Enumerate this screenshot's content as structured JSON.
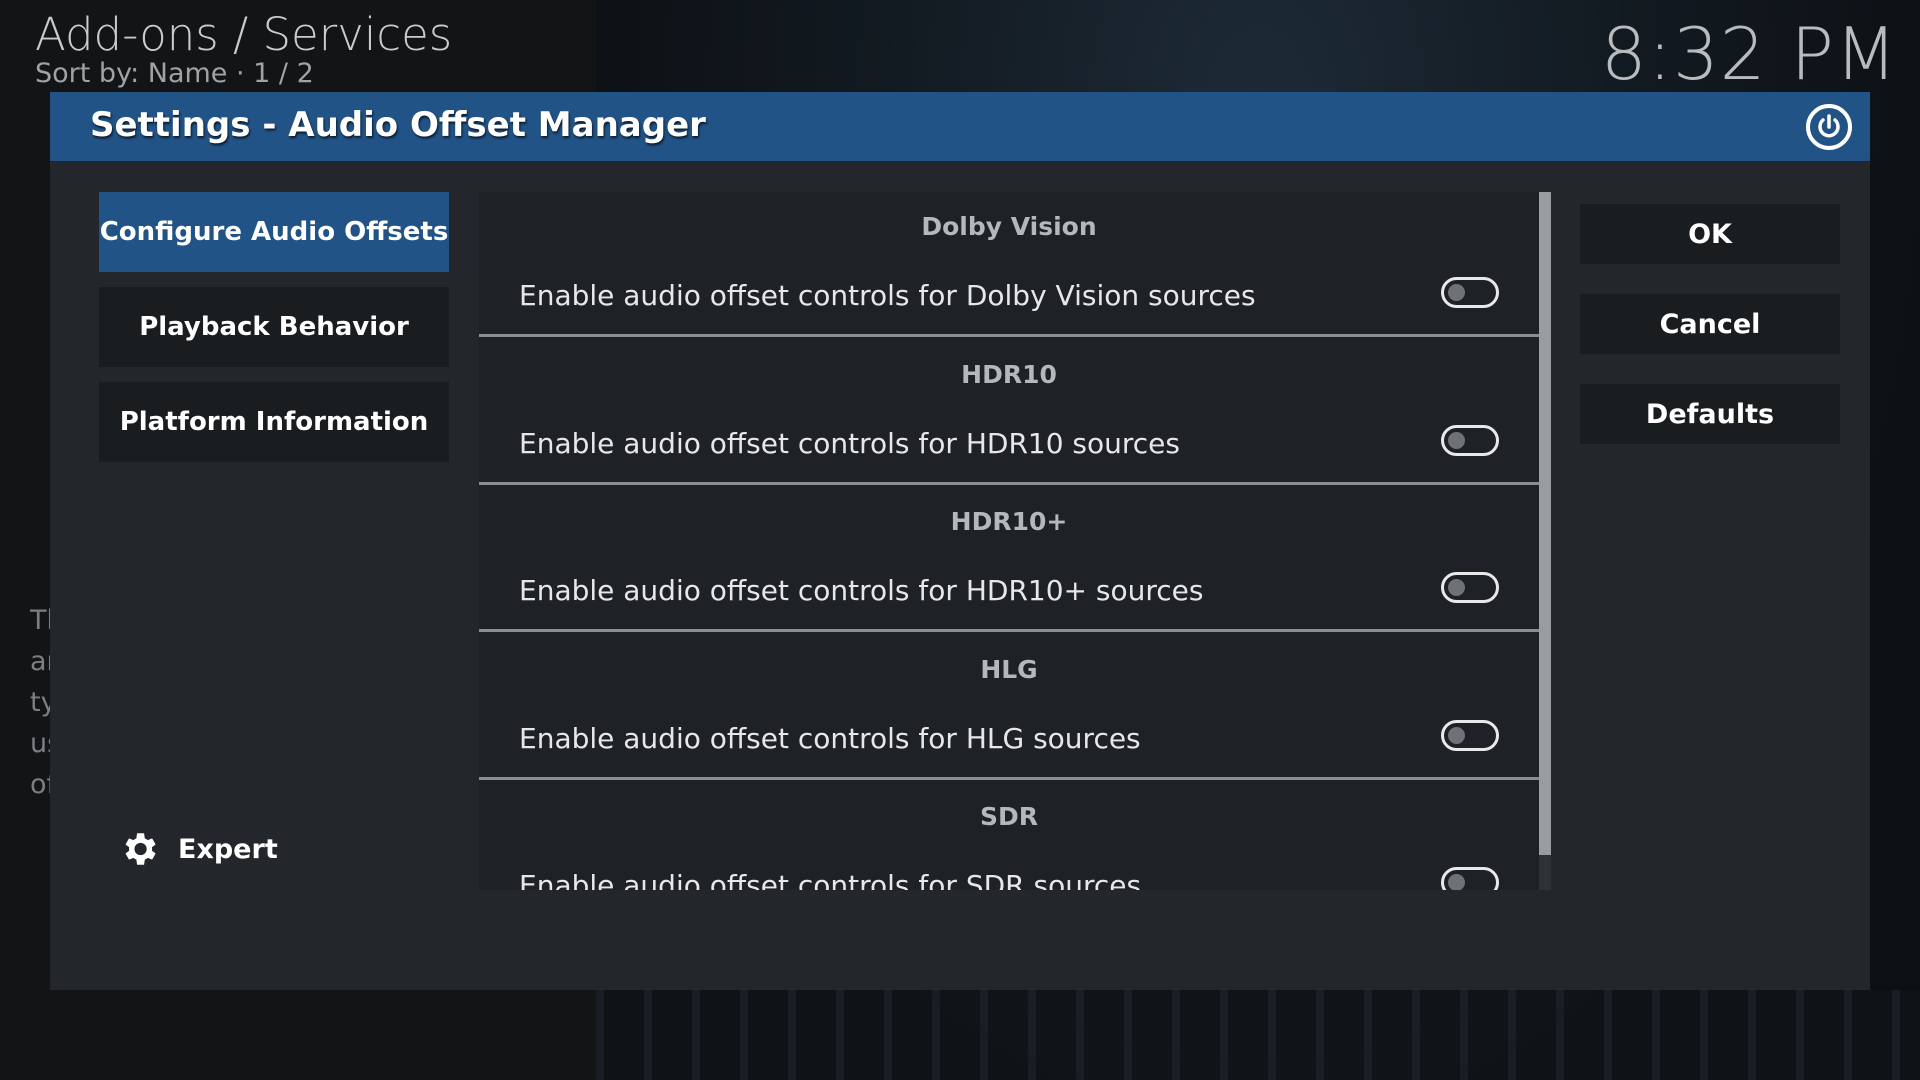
{
  "header": {
    "breadcrumb": "Add-ons / Services",
    "sort_line": "Sort by: Name  ·  1 / 2",
    "clock": "8:32 PM"
  },
  "background_text": [
    "Th",
    "ar",
    "ty",
    "us",
    "of"
  ],
  "dialog": {
    "title": "Settings - Audio Offset Manager",
    "close_icon": "power-icon",
    "categories": [
      {
        "label": "Configure Audio Offsets",
        "active": true
      },
      {
        "label": "Playback Behavior",
        "active": false
      },
      {
        "label": "Platform Information",
        "active": false
      }
    ],
    "level": {
      "label": "Expert",
      "icon": "gear-icon"
    },
    "groups": [
      {
        "title": "Dolby Vision",
        "setting": "Enable audio offset controls for Dolby Vision sources",
        "enabled": false
      },
      {
        "title": "HDR10",
        "setting": "Enable audio offset controls for HDR10 sources",
        "enabled": false
      },
      {
        "title": "HDR10+",
        "setting": "Enable audio offset controls for HDR10+ sources",
        "enabled": false
      },
      {
        "title": "HLG",
        "setting": "Enable audio offset controls for HLG sources",
        "enabled": false
      },
      {
        "title": "SDR",
        "setting": "Enable audio offset controls for SDR sources",
        "enabled": false
      }
    ],
    "buttons": {
      "ok": "OK",
      "cancel": "Cancel",
      "defaults": "Defaults"
    }
  },
  "colors": {
    "accent": "#225386",
    "dialog_bg": "#23272b",
    "panel_bg": "#1a1d20"
  }
}
